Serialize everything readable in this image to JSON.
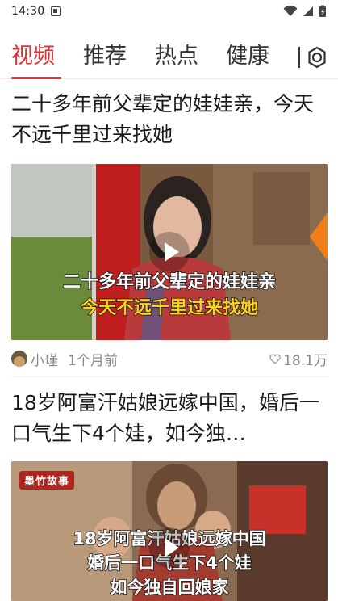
{
  "status_bar": {
    "time": "14:30"
  },
  "tabs": [
    {
      "label": "视频",
      "active": true
    },
    {
      "label": "推荐",
      "active": false
    },
    {
      "label": "热点",
      "active": false
    },
    {
      "label": "健康",
      "active": false
    }
  ],
  "settings_icon": "gear-icon",
  "articles": [
    {
      "title": "二十多年前父辈定的娃娃亲，今天不远千里过来找她",
      "caption_line1": "二十多年前父辈定的娃娃亲",
      "caption_line2": "今天不远千里过来找她",
      "author": "小瑾",
      "date": "1个月前",
      "likes": "18.1万"
    },
    {
      "title": "18岁阿富汗姑娘远嫁中国，婚后一口气生下4个娃，如今独…",
      "watermark": "墨竹故事",
      "caption_line1": "18岁阿富汗姑娘远嫁中国",
      "caption_line2": "婚后一口气生下4个娃",
      "caption_line3": "如今独自回娘家"
    }
  ],
  "colors": {
    "accent": "#e03131",
    "caption_yellow": "#ffd21a"
  }
}
